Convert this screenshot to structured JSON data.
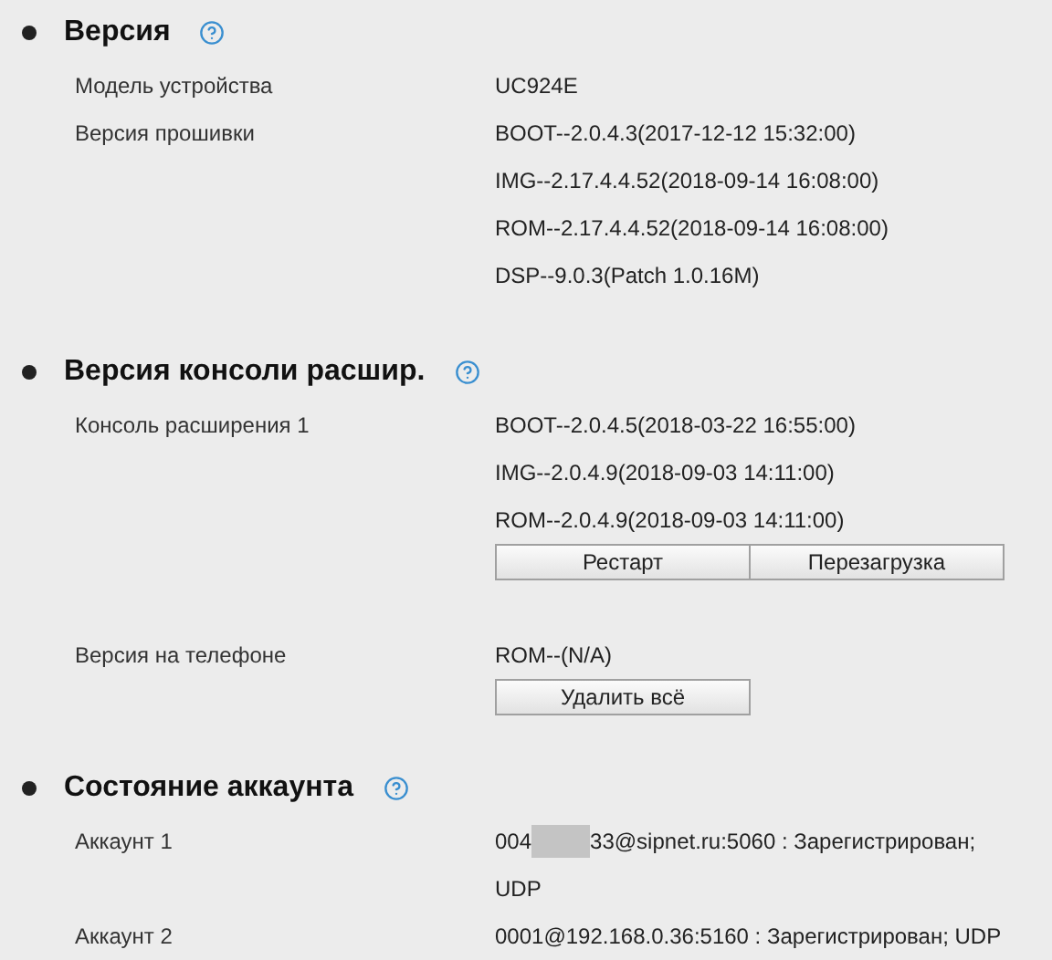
{
  "sections": [
    {
      "title": "Версия",
      "rows": [
        {
          "label": "Модель устройства",
          "lines": [
            "UC924E"
          ]
        },
        {
          "label": "Версия прошивки",
          "lines": [
            "BOOT--2.0.4.3(2017-12-12 15:32:00)",
            "IMG--2.17.4.4.52(2018-09-14 16:08:00)",
            "ROM--2.17.4.4.52(2018-09-14 16:08:00)",
            "DSP--9.0.3(Patch 1.0.16M)"
          ]
        }
      ]
    },
    {
      "title": "Версия консоли расшир.",
      "rows": [
        {
          "label": "Консоль расширения 1",
          "lines": [
            "BOOT--2.0.4.5(2018-03-22 16:55:00)",
            "IMG--2.0.4.9(2018-09-03 14:11:00)",
            "ROM--2.0.4.9(2018-09-03 14:11:00)"
          ],
          "buttons": [
            "Рестарт",
            "Перезагрузка"
          ]
        },
        {
          "label": "Версия на телефоне",
          "lines": [
            "ROM--(N/A)"
          ],
          "buttons": [
            "Удалить всё"
          ]
        }
      ]
    },
    {
      "title": "Состояние аккаунта",
      "rows": [
        {
          "label": "Аккаунт 1",
          "lines": [
            {
              "before": "004",
              "redacted": true,
              "after": "33@sipnet.ru:5060 : Зарегистрирован;"
            },
            "UDP"
          ]
        },
        {
          "label": "Аккаунт 2",
          "lines": [
            "0001@192.168.0.36:5160 : Зарегистрирован; UDP"
          ]
        }
      ]
    }
  ]
}
